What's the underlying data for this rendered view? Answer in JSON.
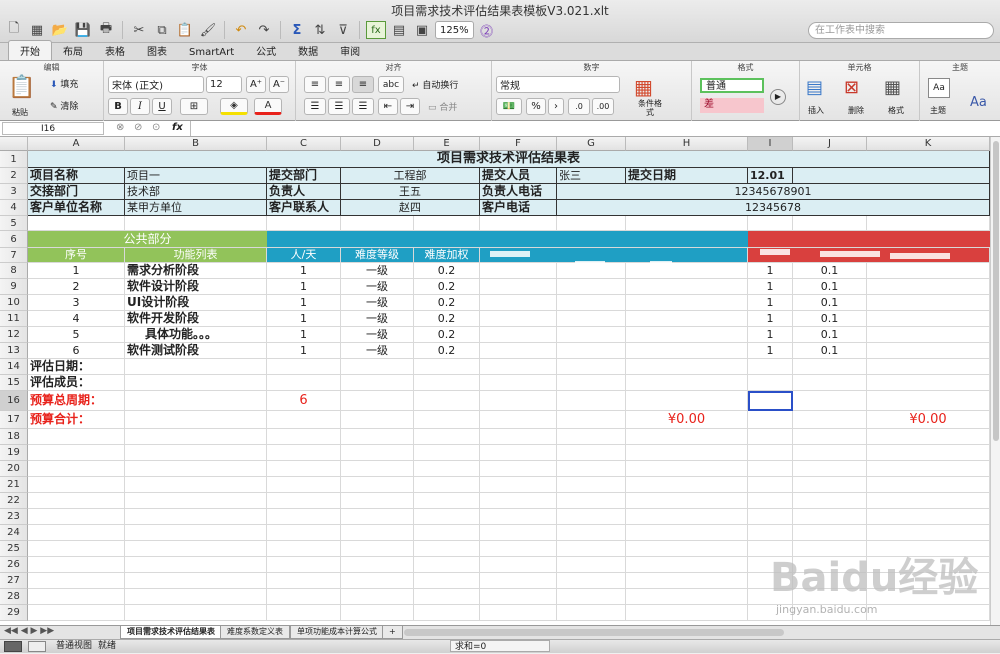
{
  "window": {
    "title": "项目需求技术评估结果表模板V3.021.xlt"
  },
  "toolbar": {
    "zoom": "125%",
    "search_placeholder": "在工作表中搜索"
  },
  "ribbon": {
    "tabs": [
      "开始",
      "布局",
      "表格",
      "图表",
      "SmartArt",
      "公式",
      "数据",
      "审阅"
    ],
    "active_tab": "开始",
    "groups": {
      "edit": "编辑",
      "font": "字体",
      "align": "对齐",
      "number": "数字",
      "format": "格式",
      "cells": "单元格",
      "theme": "主题"
    },
    "paste": "粘贴",
    "fill": "填充",
    "clear": "清除",
    "font_name": "宋体 (正文)",
    "font_size": "12",
    "wrap": "自动换行",
    "merge": "合并",
    "number_format": "常规",
    "cond_format": "条件格式",
    "style_normal": "普通",
    "style_bad": "差",
    "insert": "插入",
    "delete": "删除",
    "format": "格式",
    "theme": "主题"
  },
  "formula_bar": {
    "name_box": "I16",
    "fx": "fx"
  },
  "columns": [
    "A",
    "B",
    "C",
    "D",
    "E",
    "F",
    "G",
    "H",
    "I",
    "J",
    "K"
  ],
  "rows": [
    "1",
    "2",
    "3",
    "4",
    "5",
    "6",
    "7",
    "8",
    "9",
    "10",
    "11",
    "12",
    "13",
    "14",
    "15",
    "16",
    "17",
    "18",
    "19",
    "20",
    "21",
    "22",
    "23",
    "24",
    "25",
    "26",
    "27",
    "28",
    "29"
  ],
  "sheet": {
    "title": "项目需求技术评估结果表",
    "r2": {
      "a": "项目名称",
      "b": "项目一",
      "c": "提交部门",
      "d": "工程部",
      "f": "提交人员",
      "g": "张三",
      "h": "提交日期",
      "i": "12.01"
    },
    "r3": {
      "a": "交接部门",
      "b": "技术部",
      "c": "负责人",
      "d": "王五",
      "f": "负责人电话",
      "g": "12345678901"
    },
    "r4": {
      "a": "客户单位名称",
      "b": "某甲方单位",
      "c": "客户联系人",
      "d": "赵四",
      "f": "客户电话",
      "g": "12345678"
    },
    "section_public": "公共部分",
    "headers": {
      "a": "序号",
      "b": "功能列表",
      "c": "人/天",
      "d": "难度等级",
      "e": "难度加权"
    },
    "items": [
      {
        "no": "1",
        "name": "需求分析阶段",
        "pd": "1",
        "level": "一级",
        "w": "0.2",
        "i": "1",
        "j": "0.1"
      },
      {
        "no": "2",
        "name": "软件设计阶段",
        "pd": "1",
        "level": "一级",
        "w": "0.2",
        "i": "1",
        "j": "0.1"
      },
      {
        "no": "3",
        "name": "UI设计阶段",
        "pd": "1",
        "level": "一级",
        "w": "0.2",
        "i": "1",
        "j": "0.1"
      },
      {
        "no": "4",
        "name": "软件开发阶段",
        "pd": "1",
        "level": "一级",
        "w": "0.2",
        "i": "1",
        "j": "0.1"
      },
      {
        "no": "5",
        "name": "具体功能。。。",
        "pd": "1",
        "level": "一级",
        "w": "0.2",
        "i": "1",
        "j": "0.1"
      },
      {
        "no": "6",
        "name": "软件测试阶段",
        "pd": "1",
        "level": "一级",
        "w": "0.2",
        "i": "1",
        "j": "0.1"
      }
    ],
    "r14": "评估日期：",
    "r15": "评估成员：",
    "r16": {
      "label": "预算总周期：",
      "value": "6"
    },
    "r17": {
      "label": "预算合计：",
      "h": "¥0.00",
      "k": "¥0.00"
    }
  },
  "sheet_tabs": [
    "项目需求技术评估结果表",
    "难度系数定义表",
    "单项功能成本计算公式",
    "+"
  ],
  "status": {
    "view": "普通视图",
    "ready": "就绪",
    "sum": "求和=0"
  },
  "watermark": {
    "main": "Baidu经验",
    "sub": "jingyan.baidu.com"
  },
  "colors": {
    "green": "#92c35a",
    "teal": "#1f9fc4",
    "red": "#d9403e",
    "lightblue": "#dbeef3",
    "redtext": "#e8221b"
  }
}
